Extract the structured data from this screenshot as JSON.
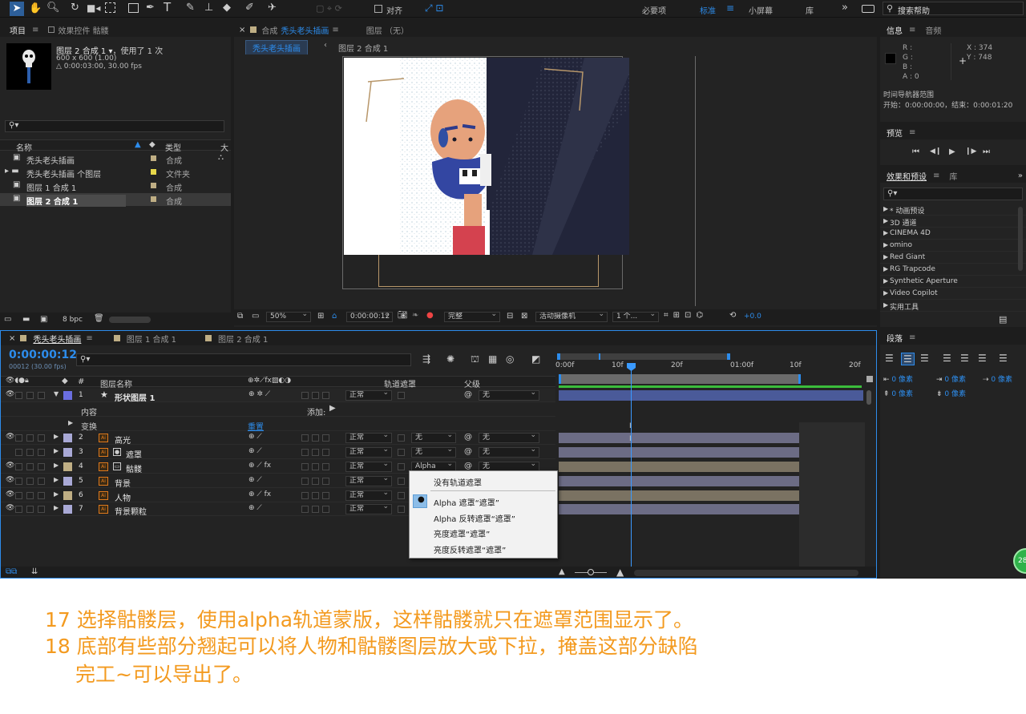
{
  "toolbar": {
    "workspaces": [
      "必要项",
      "标准",
      "小屏幕",
      "库"
    ],
    "menu_icon": "≡",
    "more": "»",
    "snap_label": "对齐",
    "search_placeholder": "搜索帮助"
  },
  "project": {
    "tabs": [
      "项目",
      "效果控件 骷髅"
    ],
    "item_name": "图层 2 合成 1",
    "item_used": "，使用了 1 次",
    "item_size": "600 x 600 (1.00)",
    "item_duration": "△ 0:00:03:00, 30.00 fps",
    "col_name": "名称",
    "col_type": "类型",
    "col_size": "大",
    "rows": [
      {
        "name": "秃头老头插画",
        "type": "合成"
      },
      {
        "name": "秃头老头插画 个图层",
        "type": "文件夹"
      },
      {
        "name": "图层 1 合成 1",
        "type": "合成"
      },
      {
        "name": "图层 2 合成 1",
        "type": "合成"
      }
    ],
    "bpc": "8 bpc"
  },
  "viewer": {
    "comp_label": "合成",
    "comp_name": "秃头老头插画",
    "layer_label": "图层 （无）",
    "breadcrumb_active": "秃头老头插画",
    "breadcrumb_next": "图层 2 合成 1",
    "zoom": "50%",
    "timecode": "0:00:00:12",
    "quality": "完整",
    "camera": "活动摄像机",
    "views": "1 个...",
    "exposure": "+0.0"
  },
  "info": {
    "tabs": [
      "信息",
      "音频"
    ],
    "r": "R :",
    "g": "G :",
    "b": "B :",
    "a": "A : 0",
    "x": "X : 374",
    "y": "Y : 748",
    "nav_title": "时间导航器范围",
    "nav_range": "开始：0:00:00:00，结束：0:00:01:20"
  },
  "preview": {
    "title": "预览",
    "controls": [
      "⏮",
      "◀❙",
      "▶",
      "❙▶",
      "⏭"
    ]
  },
  "effects": {
    "tabs": [
      "效果和预设",
      "库"
    ],
    "items": [
      "* 动画预设",
      "3D 通道",
      "CINEMA 4D",
      "omino",
      "Red Giant",
      "RG Trapcode",
      "Synthetic Aperture",
      "Video Copilot",
      "实用工具"
    ]
  },
  "paragraph": {
    "title": "段落",
    "val": "0 像素"
  },
  "timeline": {
    "tabs": [
      "秃头老头插画",
      "图层 1 合成 1",
      "图层 2 合成 1"
    ],
    "timecode": "0:00:00:12",
    "frames": "00012 (30.00 fps)",
    "col_num": "#",
    "col_name": "图层名称",
    "col_trackmatte": "轨道遮罩",
    "col_parent": "父级",
    "ticks": [
      "0:00f",
      "10f",
      "20f",
      "01:00f",
      "10f",
      "20f"
    ],
    "layers": [
      {
        "num": "1",
        "name": "形状图层 1",
        "mode": "正常",
        "matte": "",
        "parent": "无",
        "fx": false
      },
      {
        "num": "2",
        "name": "高光",
        "mode": "正常",
        "matte": "无",
        "parent": "无",
        "fx": false
      },
      {
        "num": "3",
        "name": "遮罩",
        "mode": "正常",
        "matte": "无",
        "parent": "无",
        "fx": false
      },
      {
        "num": "4",
        "name": "骷髅",
        "mode": "正常",
        "matte": "Alpha",
        "parent": "无",
        "fx": true
      },
      {
        "num": "5",
        "name": "背景",
        "mode": "正常",
        "matte": "",
        "parent": "无",
        "fx": false
      },
      {
        "num": "6",
        "name": "人物",
        "mode": "正常",
        "matte": "",
        "parent": "无",
        "fx": true
      },
      {
        "num": "7",
        "name": "背景颗粒",
        "mode": "正常",
        "matte": "",
        "parent": "无",
        "fx": false
      }
    ],
    "content_label": "内容",
    "add_label": "添加:",
    "transform_label": "变换",
    "reset_label": "重置",
    "corner_badge": "28"
  },
  "matte_menu": {
    "items": [
      "没有轨道遮罩",
      "Alpha 遮罩“遮罩”",
      "Alpha 反转遮罩“遮罩”",
      "亮度遮罩“遮罩”",
      "亮度反转遮罩“遮罩”"
    ],
    "selected_index": 1
  },
  "captions": [
    "17 选择骷髅层，使用alpha轨道蒙版，这样骷髅就只在遮罩范围显示了。",
    "18 底部有些部分翘起可以将人物和骷髅图层放大或下拉，掩盖这部分缺陷",
    "完工~可以导出了。"
  ],
  "colors": {
    "accent_blue": "#2d8ceb",
    "caption_orange": "#f39a1f",
    "shape_layer_bar": "#4a5a99",
    "layer_bar": "#6c6c85",
    "layer_bar_tan": "#7a7262",
    "playhead": "#3a9aff"
  }
}
